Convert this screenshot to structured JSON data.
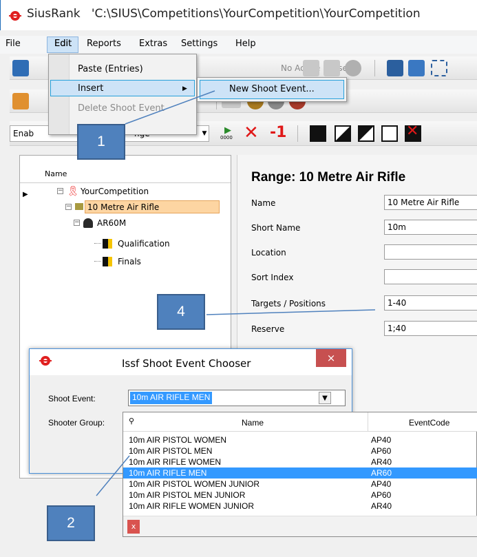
{
  "window": {
    "app_name": "SiusRank",
    "path": "'C:\\SIUS\\Competitions\\YourCompetition\\YourCompetition"
  },
  "menubar": [
    "File",
    "Edit",
    "Reports",
    "Extras",
    "Settings",
    "Help"
  ],
  "toolbar": {
    "phase_label": "No Active Phase",
    "enable_label": "Enab",
    "range_partial": "nge",
    "minus_one": "-1",
    "counter_label": "0000"
  },
  "edit_menu": {
    "items": [
      "Paste (Entries)",
      "Insert",
      "Delete Shoot Event"
    ],
    "submenu_arrow": "▶",
    "insert_submenu": [
      "New Shoot Event..."
    ]
  },
  "callouts": [
    "1",
    "2",
    "4"
  ],
  "tree": {
    "header": "Name",
    "root": "YourCompetition",
    "range": "10 Metre Air Rifle",
    "event": "AR60M",
    "phases": [
      "Qualification",
      "Finals"
    ]
  },
  "detail": {
    "heading": "Range: 10 Metre Air Rifle",
    "fields": [
      {
        "label": "Name",
        "value": "10 Metre Air Rifle"
      },
      {
        "label": "Short Name",
        "value": "10m"
      },
      {
        "label": "Location",
        "value": ""
      },
      {
        "label": "Sort Index",
        "value": ""
      },
      {
        "label": "Targets / Positions",
        "value": "1-40"
      },
      {
        "label": "Reserve",
        "value": "1;40"
      }
    ]
  },
  "dialog": {
    "title": "Issf Shoot Event Chooser",
    "close": "×",
    "shoot_event_label": "Shoot Event:",
    "shooter_group_label": "Shooter Group:",
    "selected_value": "10m AIR RIFLE MEN",
    "arrow": "▼"
  },
  "event_list": {
    "columns": [
      "Name",
      "EventCode"
    ],
    "search_icon": "binoculars-icon",
    "rows": [
      {
        "name": "10m AIR PISTOL WOMEN",
        "code": "AP40",
        "selected": false
      },
      {
        "name": "10m AIR PISTOL MEN",
        "code": "AP60",
        "selected": false
      },
      {
        "name": "10m AIR RIFLE WOMEN",
        "code": "AR40",
        "selected": false
      },
      {
        "name": "10m AIR RIFLE MEN",
        "code": "AR60",
        "selected": true
      },
      {
        "name": "10m AIR PISTOL WOMEN JUNIOR",
        "code": "AP40",
        "selected": false
      },
      {
        "name": "10m AIR PISTOL MEN JUNIOR",
        "code": "AP60",
        "selected": false
      },
      {
        "name": "10m AIR RIFLE WOMEN JUNIOR",
        "code": "AR40",
        "selected": false
      }
    ],
    "clear_label": "x"
  },
  "colors": {
    "accent": "#3399ff",
    "callout": "#4f81bd",
    "tree_selected": "#fdd5a2",
    "close_red": "#c75050"
  }
}
